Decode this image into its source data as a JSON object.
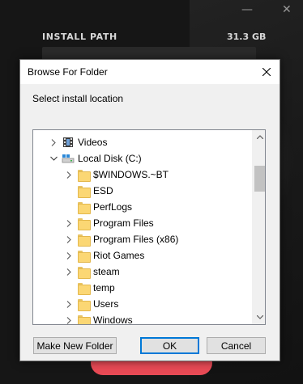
{
  "background": {
    "install_path_label": "INSTALL PATH",
    "install_size": "31.3 GB",
    "accent_color": "#e84a55"
  },
  "dialog": {
    "title": "Browse For Folder",
    "prompt": "Select install location",
    "buttons": {
      "make_new_folder": "Make New Folder",
      "ok": "OK",
      "cancel": "Cancel"
    },
    "tree": [
      {
        "label": "Videos",
        "icon": "videos-icon",
        "expander": "collapsed",
        "level": 0
      },
      {
        "label": "Local Disk (C:)",
        "icon": "drive-icon",
        "expander": "expanded",
        "level": 0
      },
      {
        "label": "$WINDOWS.~BT",
        "icon": "folder-icon",
        "expander": "collapsed",
        "level": 1
      },
      {
        "label": "ESD",
        "icon": "folder-icon",
        "expander": "none",
        "level": 1
      },
      {
        "label": "PerfLogs",
        "icon": "folder-icon",
        "expander": "none",
        "level": 1
      },
      {
        "label": "Program Files",
        "icon": "folder-icon",
        "expander": "collapsed",
        "level": 1
      },
      {
        "label": "Program Files (x86)",
        "icon": "folder-icon",
        "expander": "collapsed",
        "level": 1
      },
      {
        "label": "Riot Games",
        "icon": "folder-icon",
        "expander": "collapsed",
        "level": 1
      },
      {
        "label": "steam",
        "icon": "folder-icon",
        "expander": "collapsed",
        "level": 1
      },
      {
        "label": "temp",
        "icon": "folder-icon",
        "expander": "none",
        "level": 1
      },
      {
        "label": "Users",
        "icon": "folder-icon",
        "expander": "collapsed",
        "level": 1
      },
      {
        "label": "Windows",
        "icon": "folder-icon",
        "expander": "collapsed",
        "level": 1
      }
    ]
  }
}
